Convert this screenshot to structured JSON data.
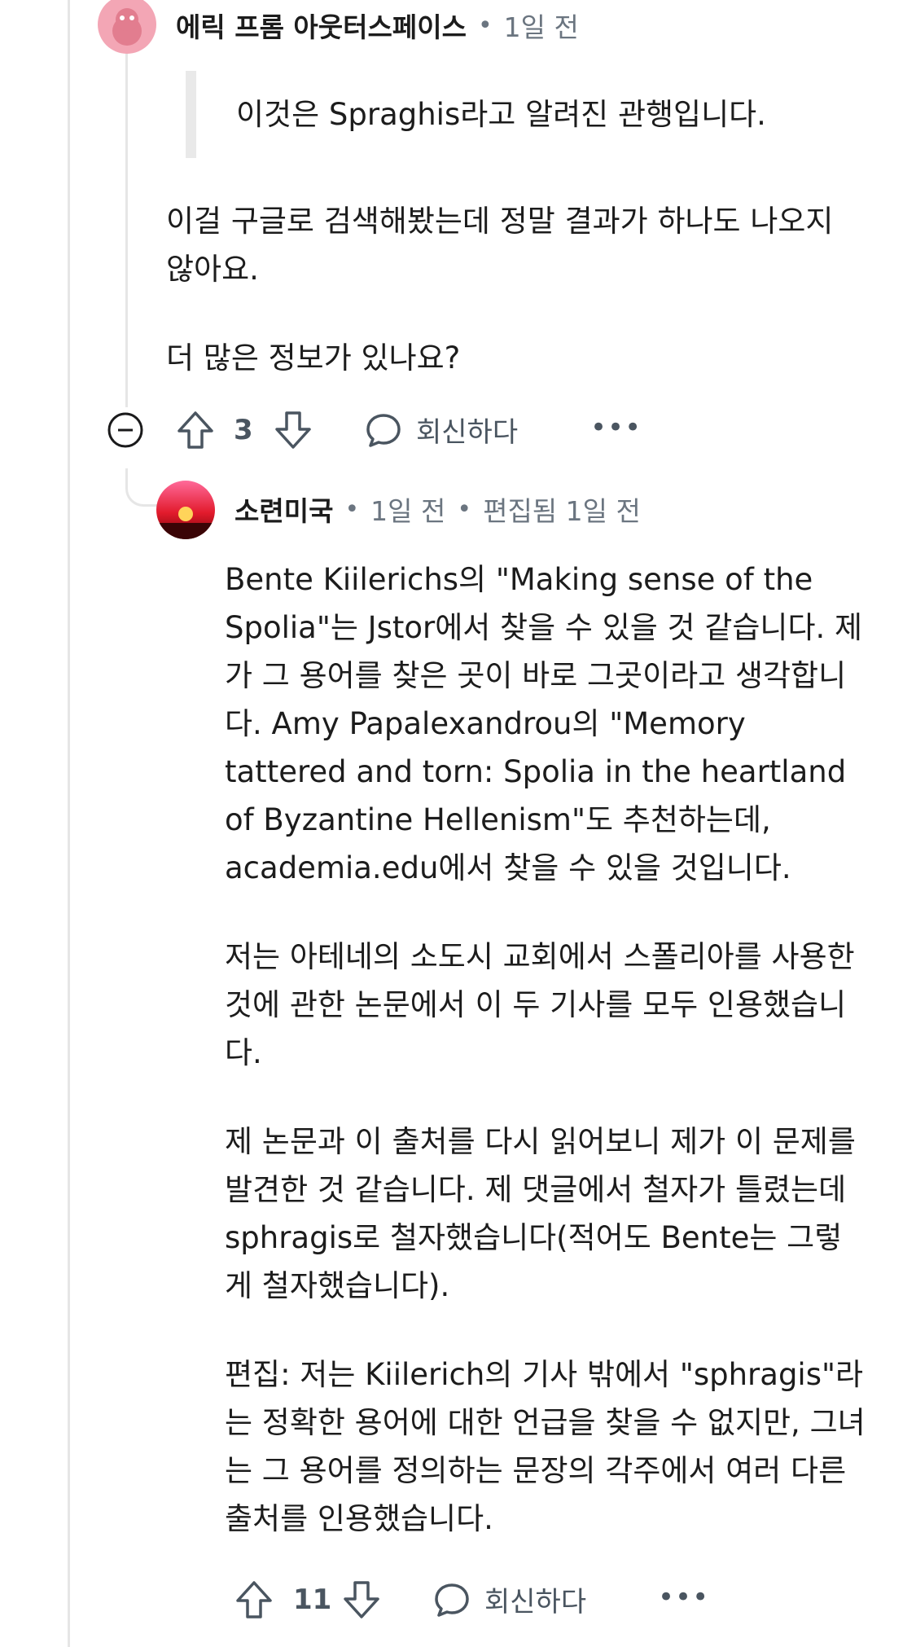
{
  "comment1": {
    "username": "에릭 프롬 아웃터스페이스",
    "time": "1일 전",
    "quote": "이것은 Spraghis라고 알려진 관행입니다.",
    "paragraphs": [
      "이걸 구글로 검색해봤는데 정말 결과가 하나도 나오지 않아요.",
      "더 많은 정보가 있나요?"
    ],
    "votes": "3",
    "reply_label": "회신하다",
    "more_label": "•••"
  },
  "comment2": {
    "username": "소련미국",
    "time": "1일 전",
    "edited": "편집됨 1일 전",
    "paragraphs": [
      "Bente Kiilerichs의 \"Making sense of the Spolia\"는 Jstor에서 찾을 수 있을 것 같습니다. 제가 그 용어를 찾은 곳이 바로 그곳이라고 생각합니다. Amy Papalexandrou의 \"Memory tattered and torn: Spolia in the heartland of Byzantine Hellenism\"도 추천하는데, academia.edu에서 찾을 수 있을 것입니다.",
      "저는 아테네의 소도시 교회에서 스폴리아를 사용한 것에 관한 논문에서 이 두 기사를 모두 인용했습니다.",
      "제 논문과 이 출처를 다시 읽어보니 제가 이 문제를 발견한 것 같습니다. 제 댓글에서 철자가 틀렸는데 sphragis로 철자했습니다(적어도 Bente는 그렇게 철자했습니다).",
      "편집: 저는 Kiilerich의 기사 밖에서 \"sphragis\"라는 정확한 용어에 대한 언급을 찾을 수 없지만, 그녀는 그 용어를 정의하는 문장의 각주에서 여러 다른 출처를 인용했습니다."
    ],
    "votes": "11",
    "reply_label": "회신하다",
    "more_label": "•••"
  },
  "icons": [
    "upvote-icon",
    "downvote-icon",
    "comment-bubble-icon",
    "collapse-icon",
    "more-icon"
  ],
  "colors": {
    "accent_avatar1": "#f3a6b5",
    "accent_avatar2": "#d81b2a",
    "meta_gray": "#6b7580"
  }
}
